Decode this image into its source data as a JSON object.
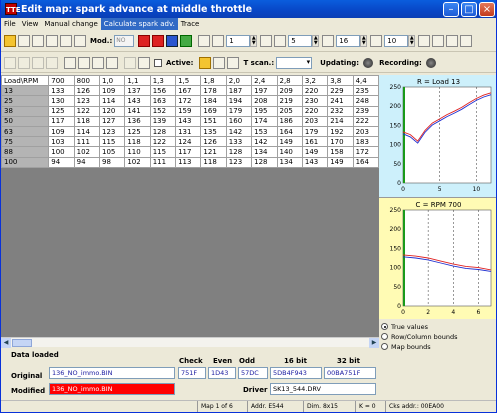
{
  "window": {
    "title": "Edit map: spark advance at middle throttle",
    "app_icon_text": "TTE"
  },
  "menu": [
    {
      "label": "File",
      "active": false
    },
    {
      "label": "View",
      "active": false
    },
    {
      "label": "Manual change",
      "active": false
    },
    {
      "label": "Calculate spark adv.",
      "active": true
    },
    {
      "label": "Trace",
      "active": false
    }
  ],
  "toolbar1": {
    "mod_label": "Mod.:",
    "mod_value": "NO",
    "spin1": "1",
    "spin2": "5",
    "spin3": "16",
    "spin4": "10"
  },
  "toolbar2": {
    "active_label": "Active:",
    "tscan_label": "T scan.:",
    "updating_label": "Updating:",
    "recording_label": "Recording:"
  },
  "grid": {
    "corner": "Load\\RPM",
    "columns": [
      "700",
      "800",
      "1,0",
      "1,1",
      "1,3",
      "1,5",
      "1,8",
      "2,0",
      "2,4",
      "2,8",
      "3,2",
      "3,8",
      "4,4"
    ],
    "rows": [
      {
        "label": "13",
        "values": [
          "133",
          "126",
          "109",
          "137",
          "156",
          "167",
          "178",
          "187",
          "197",
          "209",
          "220",
          "229",
          "235"
        ]
      },
      {
        "label": "25",
        "values": [
          "130",
          "123",
          "114",
          "143",
          "163",
          "172",
          "184",
          "194",
          "208",
          "219",
          "230",
          "241",
          "248"
        ]
      },
      {
        "label": "38",
        "values": [
          "125",
          "122",
          "120",
          "141",
          "152",
          "159",
          "169",
          "179",
          "195",
          "205",
          "220",
          "232",
          "239"
        ]
      },
      {
        "label": "50",
        "values": [
          "117",
          "118",
          "127",
          "136",
          "139",
          "143",
          "151",
          "160",
          "174",
          "186",
          "203",
          "214",
          "222"
        ]
      },
      {
        "label": "63",
        "values": [
          "109",
          "114",
          "123",
          "125",
          "128",
          "131",
          "135",
          "142",
          "153",
          "164",
          "179",
          "192",
          "203"
        ]
      },
      {
        "label": "75",
        "values": [
          "103",
          "111",
          "115",
          "118",
          "122",
          "124",
          "126",
          "133",
          "142",
          "149",
          "161",
          "170",
          "183"
        ]
      },
      {
        "label": "88",
        "values": [
          "100",
          "102",
          "105",
          "110",
          "115",
          "117",
          "121",
          "128",
          "134",
          "140",
          "149",
          "158",
          "172"
        ]
      },
      {
        "label": "100",
        "values": [
          "94",
          "94",
          "98",
          "102",
          "111",
          "113",
          "118",
          "123",
          "128",
          "134",
          "143",
          "149",
          "164"
        ]
      }
    ]
  },
  "chart_data": [
    {
      "type": "line",
      "title": "R = Load 13",
      "ylim": [
        0,
        250
      ],
      "yticks": [
        "0",
        "50",
        "100",
        "150",
        "200",
        "250"
      ],
      "xticks": [
        "0",
        "5",
        "10"
      ],
      "x": [
        0,
        1,
        2,
        3,
        4,
        5,
        6,
        7,
        8,
        9,
        10,
        11,
        12
      ],
      "series": [
        {
          "color": "#e02020",
          "values": [
            133,
            126,
            109,
            137,
            156,
            167,
            178,
            187,
            197,
            209,
            220,
            229,
            235
          ]
        },
        {
          "color": "#2030d0",
          "values": [
            128,
            120,
            104,
            132,
            151,
            162,
            173,
            182,
            192,
            204,
            215,
            224,
            230
          ]
        }
      ],
      "grid": true
    },
    {
      "type": "line",
      "title": "C = RPM 700",
      "ylim": [
        0,
        250
      ],
      "yticks": [
        "0",
        "50",
        "100",
        "150",
        "200",
        "250"
      ],
      "xticks": [
        "0",
        "2",
        "4",
        "6"
      ],
      "x": [
        0,
        1,
        2,
        3,
        4,
        5,
        6,
        7
      ],
      "series": [
        {
          "color": "#e02020",
          "values": [
            133,
            130,
            125,
            117,
            109,
            103,
            100,
            94
          ]
        },
        {
          "color": "#2030d0",
          "values": [
            128,
            125,
            120,
            112,
            104,
            98,
            95,
            90
          ]
        }
      ],
      "grid": true
    }
  ],
  "radio": [
    {
      "label": "True values",
      "checked": true
    },
    {
      "label": "Row/Column bounds",
      "checked": false
    },
    {
      "label": "Map bounds",
      "checked": false
    }
  ],
  "info": {
    "status": "Data loaded",
    "check_label": "Check",
    "even_label": "Even",
    "odd_label": "Odd",
    "bit16_label": "16 bit",
    "bit32_label": "32 bit",
    "original_label": "Original",
    "modified_label": "Modified",
    "driver_label": "Driver",
    "original_file": "136_NO_immo.BIN",
    "modified_file": "136_NO_immo.BIN",
    "check": "751F",
    "even": "1D43",
    "odd": "57DC",
    "bit16": "5DB4F943",
    "bit32": "00BA751F",
    "driver": "SK13_544.DRV"
  },
  "status_bar": {
    "map": "Map 1 of 6",
    "addr": "Addr. E544",
    "dim": "Dim. 8x15",
    "k": "K = 0",
    "cks": "Cks addr.: 00EA00"
  }
}
